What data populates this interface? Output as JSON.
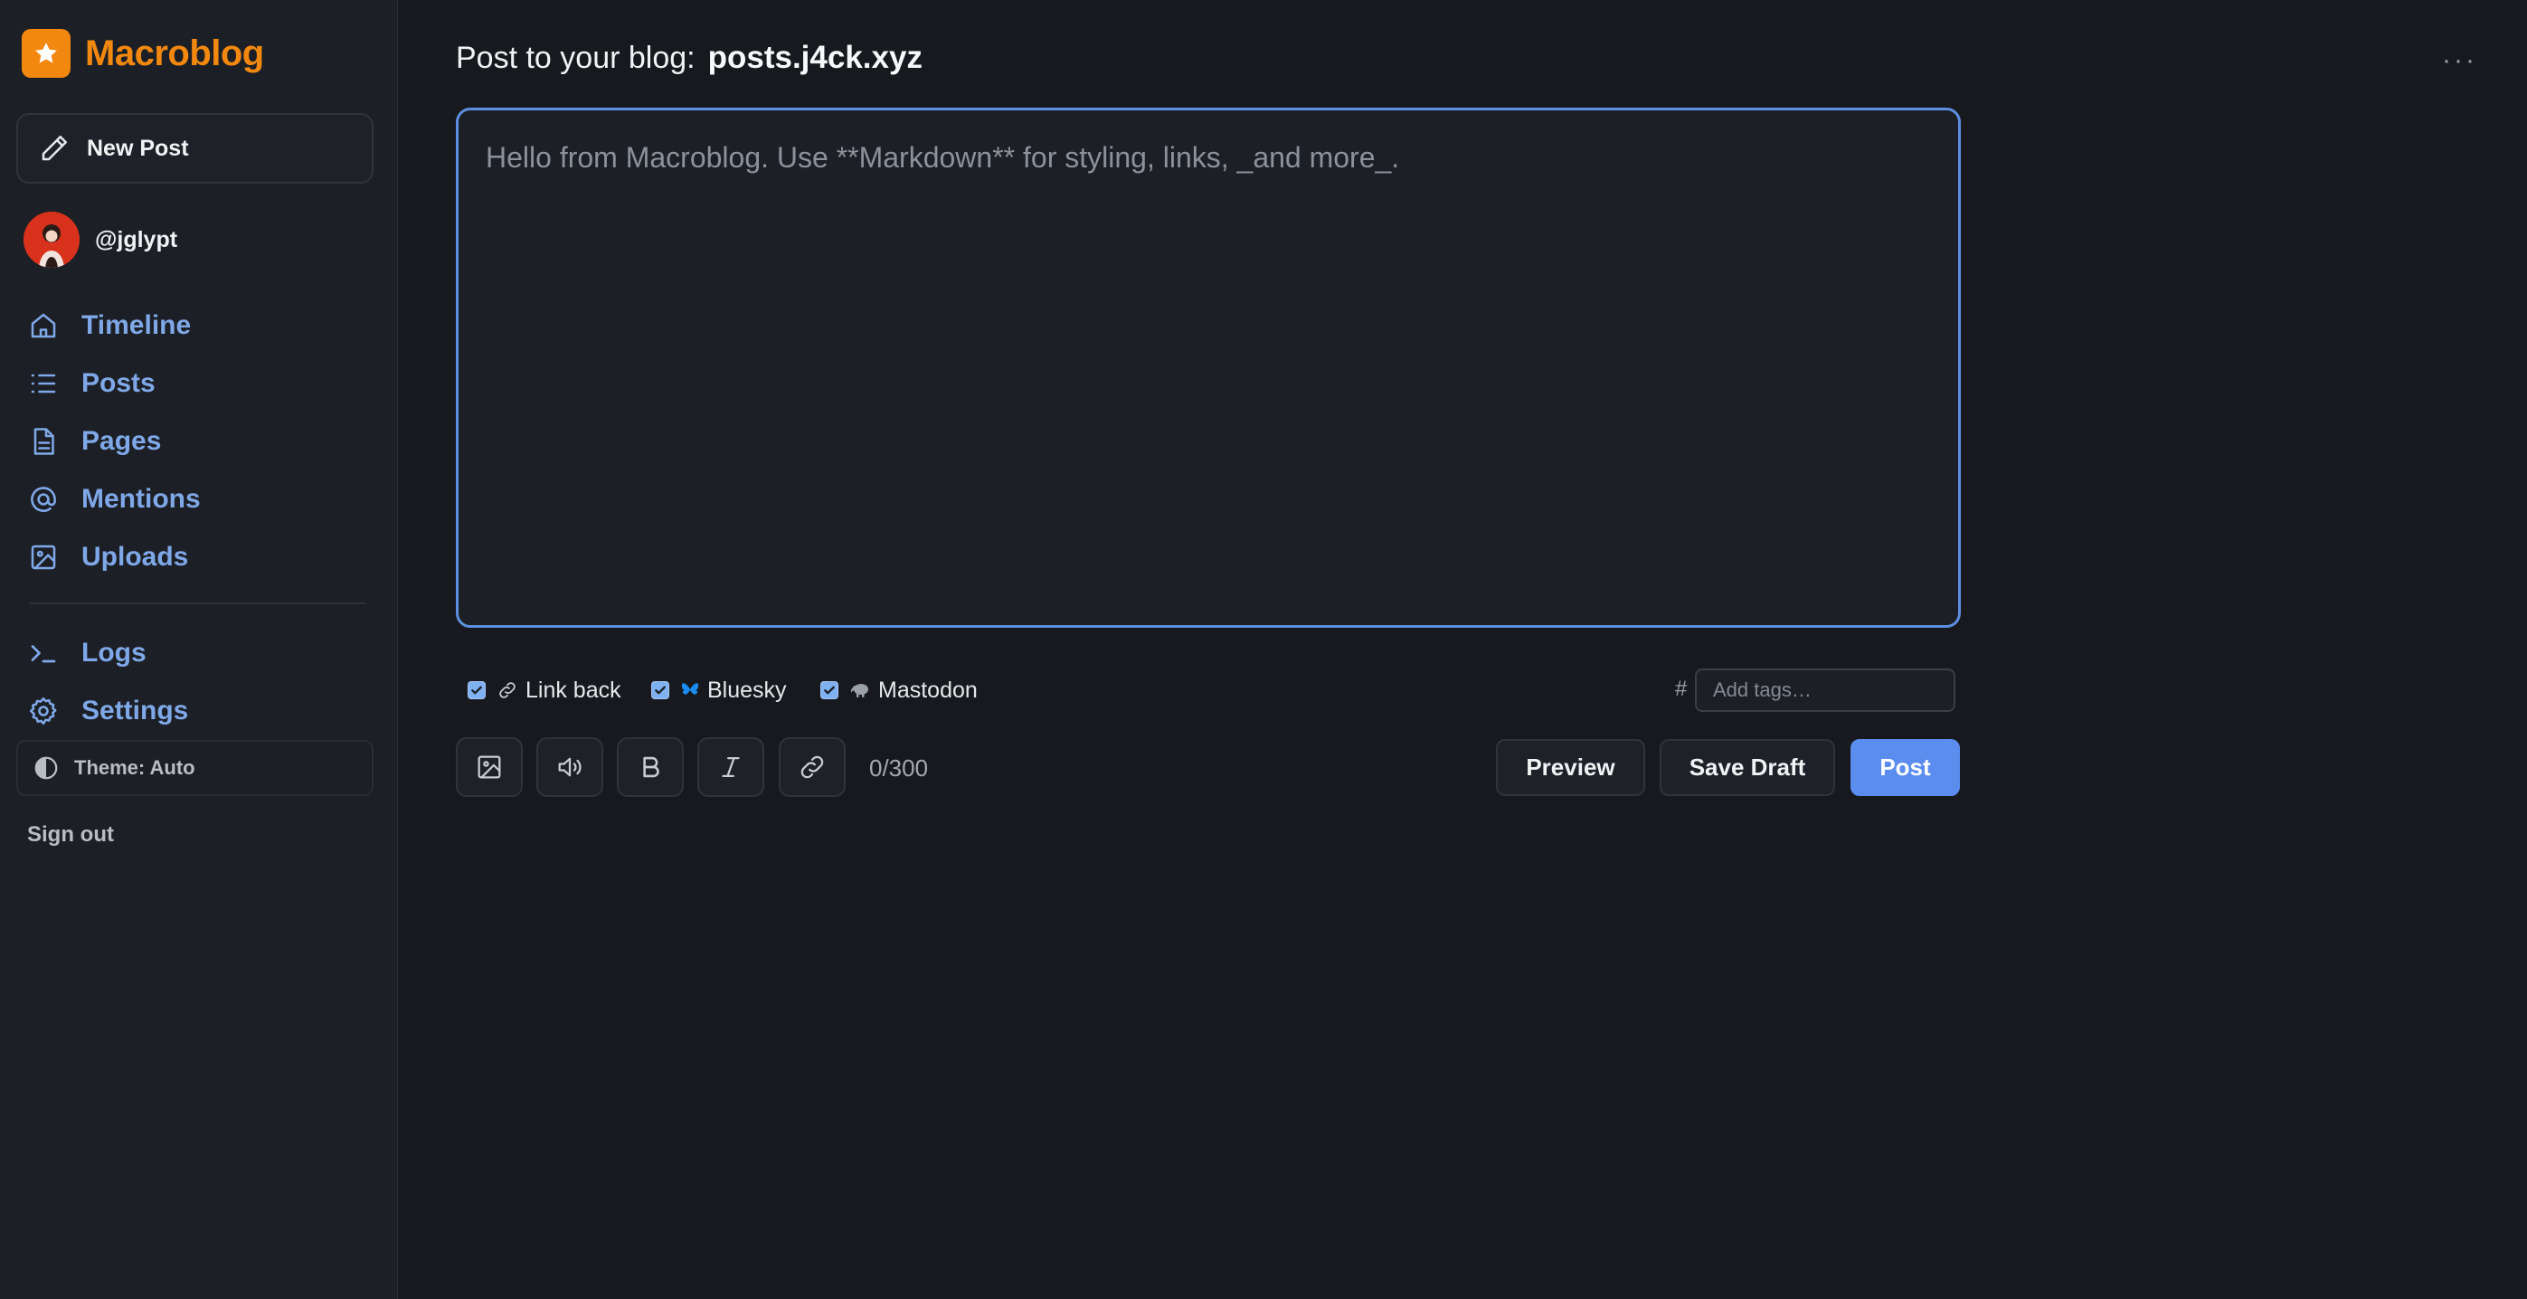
{
  "brand": {
    "name": "Macroblog",
    "accent": "#f2880f"
  },
  "sidebar": {
    "new_post": "New Post",
    "user": {
      "handle": "@jglypt"
    },
    "nav_primary": [
      {
        "label": "Timeline",
        "icon": "home-icon"
      },
      {
        "label": "Posts",
        "icon": "list-icon"
      },
      {
        "label": "Pages",
        "icon": "document-icon"
      },
      {
        "label": "Mentions",
        "icon": "at-icon"
      },
      {
        "label": "Uploads",
        "icon": "image-icon"
      }
    ],
    "nav_secondary": [
      {
        "label": "Logs",
        "icon": "terminal-icon"
      },
      {
        "label": "Settings",
        "icon": "gear-icon"
      }
    ],
    "theme": "Theme: Auto",
    "sign_out": "Sign out",
    "nav_color": "#7fa8e8"
  },
  "main": {
    "header_prefix": "Post to your blog:",
    "blog_name": "posts.j4ck.xyz",
    "editor": {
      "value": "",
      "placeholder": "Hello from Macroblog. Use **Markdown** for styling, links, _and more_."
    },
    "options": [
      {
        "label": "Link back",
        "checked": true,
        "icon": "link-icon"
      },
      {
        "label": "Bluesky",
        "checked": true,
        "icon": "butterfly-icon"
      },
      {
        "label": "Mastodon",
        "checked": true,
        "icon": "mastodon-icon"
      }
    ],
    "tags": {
      "prefix": "#",
      "placeholder": "Add tags…",
      "value": ""
    },
    "toolbar": [
      "image-icon",
      "audio-icon",
      "bold-icon",
      "italic-icon",
      "link-icon"
    ],
    "counter": "0/300",
    "buttons": {
      "preview": "Preview",
      "save_draft": "Save Draft",
      "post": "Post"
    },
    "primary_color": "#5b8def"
  }
}
